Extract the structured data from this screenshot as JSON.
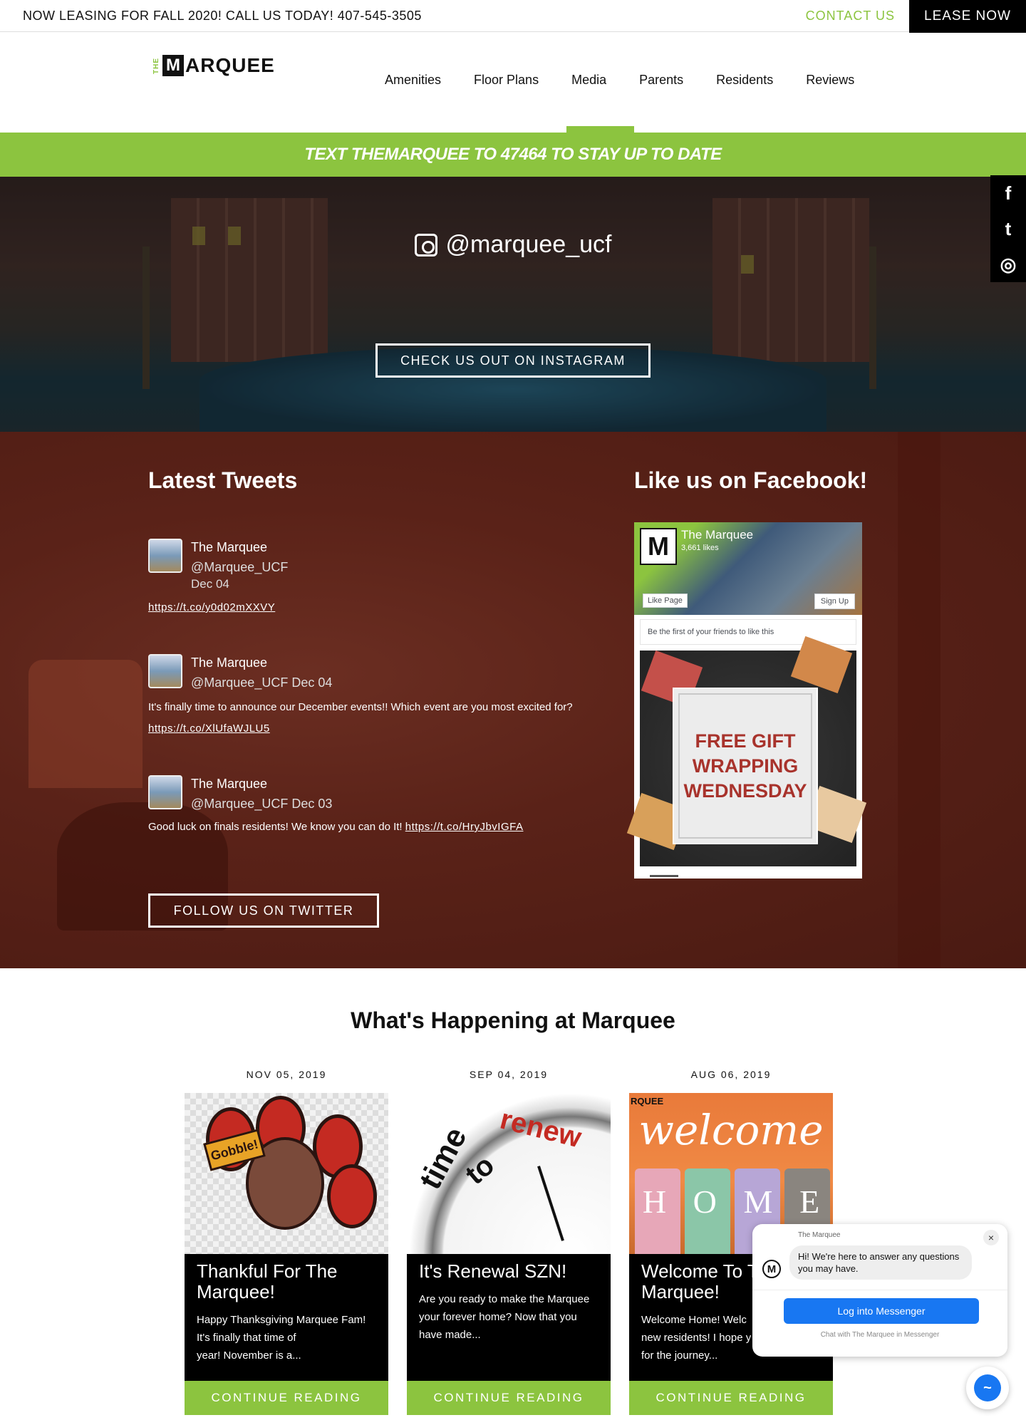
{
  "topbar": {
    "message": "NOW LEASING FOR FALL 2020! CALL US TODAY! 407-545-3505",
    "contact": "CONTACT US",
    "lease_now": "LEASE NOW"
  },
  "logo": {
    "the": "THE",
    "m": "M",
    "word": "ARQUEE"
  },
  "nav": {
    "items": [
      "Amenities",
      "Floor Plans",
      "Media",
      "Parents",
      "Residents",
      "Reviews"
    ],
    "active": "Media"
  },
  "textbar": "TEXT THEMARQUEE TO 47464 TO STAY UP TO DATE",
  "social_bar": {
    "icons": [
      "facebook-icon",
      "twitter-icon",
      "instagram-icon"
    ],
    "glyphs": [
      "f",
      "t",
      "◎"
    ]
  },
  "instagram": {
    "handle": "@marquee_ucf",
    "button": "CHECK US OUT ON INSTAGRAM"
  },
  "tweets": {
    "title": "Latest Tweets",
    "items": [
      {
        "name": "The Marquee",
        "handle": "@Marquee_UCF",
        "date": "Dec 04",
        "text": "",
        "link": "https://t.co/y0d02mXXVY"
      },
      {
        "name": "The Marquee",
        "handle": "@Marquee_UCF Dec 04",
        "text": "It's finally time to announce our December events!! Which event are you most excited for?",
        "link": "https://t.co/XlUfaWJLU5"
      },
      {
        "name": "The Marquee",
        "handle": "@Marquee_UCF Dec 03",
        "text": "Good luck on finals residents! We know you can do It! ",
        "link": "https://t.co/HryJbvIGFA"
      }
    ],
    "follow_button": "FOLLOW US ON TWITTER"
  },
  "facebook": {
    "title": "Like us on Facebook!",
    "page_name": "The Marquee",
    "likes": "3,661 likes",
    "like_page": "Like Page",
    "sign_up": "Sign Up",
    "friends_text": "Be the first of your friends to like this",
    "post_text": "FREE GIFT\nWRAPPING\nWEDNESDAY",
    "logo_letter": "M"
  },
  "happening": {
    "title": "What's Happening at Marquee",
    "posts": [
      {
        "date": "NOV 05, 2019",
        "title": "Thankful For The\nMarquee!",
        "excerpt": "Happy Thanksgiving Marquee Fam!\nIt's finally that time of\nyear! November is a...",
        "cta": "CONTINUE READING",
        "image_text": "Gobble!"
      },
      {
        "date": "SEP 04, 2019",
        "title": "It's Renewal SZN!",
        "excerpt": "Are you ready to make the Marquee\nyour forever home?  Now that you\nhave made...",
        "cta": "CONTINUE READING",
        "image_text": [
          "time",
          "to",
          "renew"
        ]
      },
      {
        "date": "AUG 06, 2019",
        "title": "Welcome To T\nMarquee!",
        "excerpt": "Welcome Home! Welc\nnew residents! I hope y\nfor the journey...",
        "cta": "CONTINUE READING",
        "image_text": {
          "brand": "RQUEE",
          "welcome": "welcome",
          "home": [
            "H",
            "O",
            "M",
            "E"
          ]
        }
      }
    ]
  },
  "messenger": {
    "from": "The Marquee",
    "message": "Hi! We're here to answer any questions you may have.",
    "login": "Log into Messenger",
    "chat_with": "Chat with The Marquee in Messenger",
    "close": "×",
    "avatar_letter": "M"
  },
  "colors": {
    "accent": "#8cc43f",
    "dark": "#000000",
    "messenger": "#1877f2",
    "tweets_bg": "#5a2218"
  }
}
